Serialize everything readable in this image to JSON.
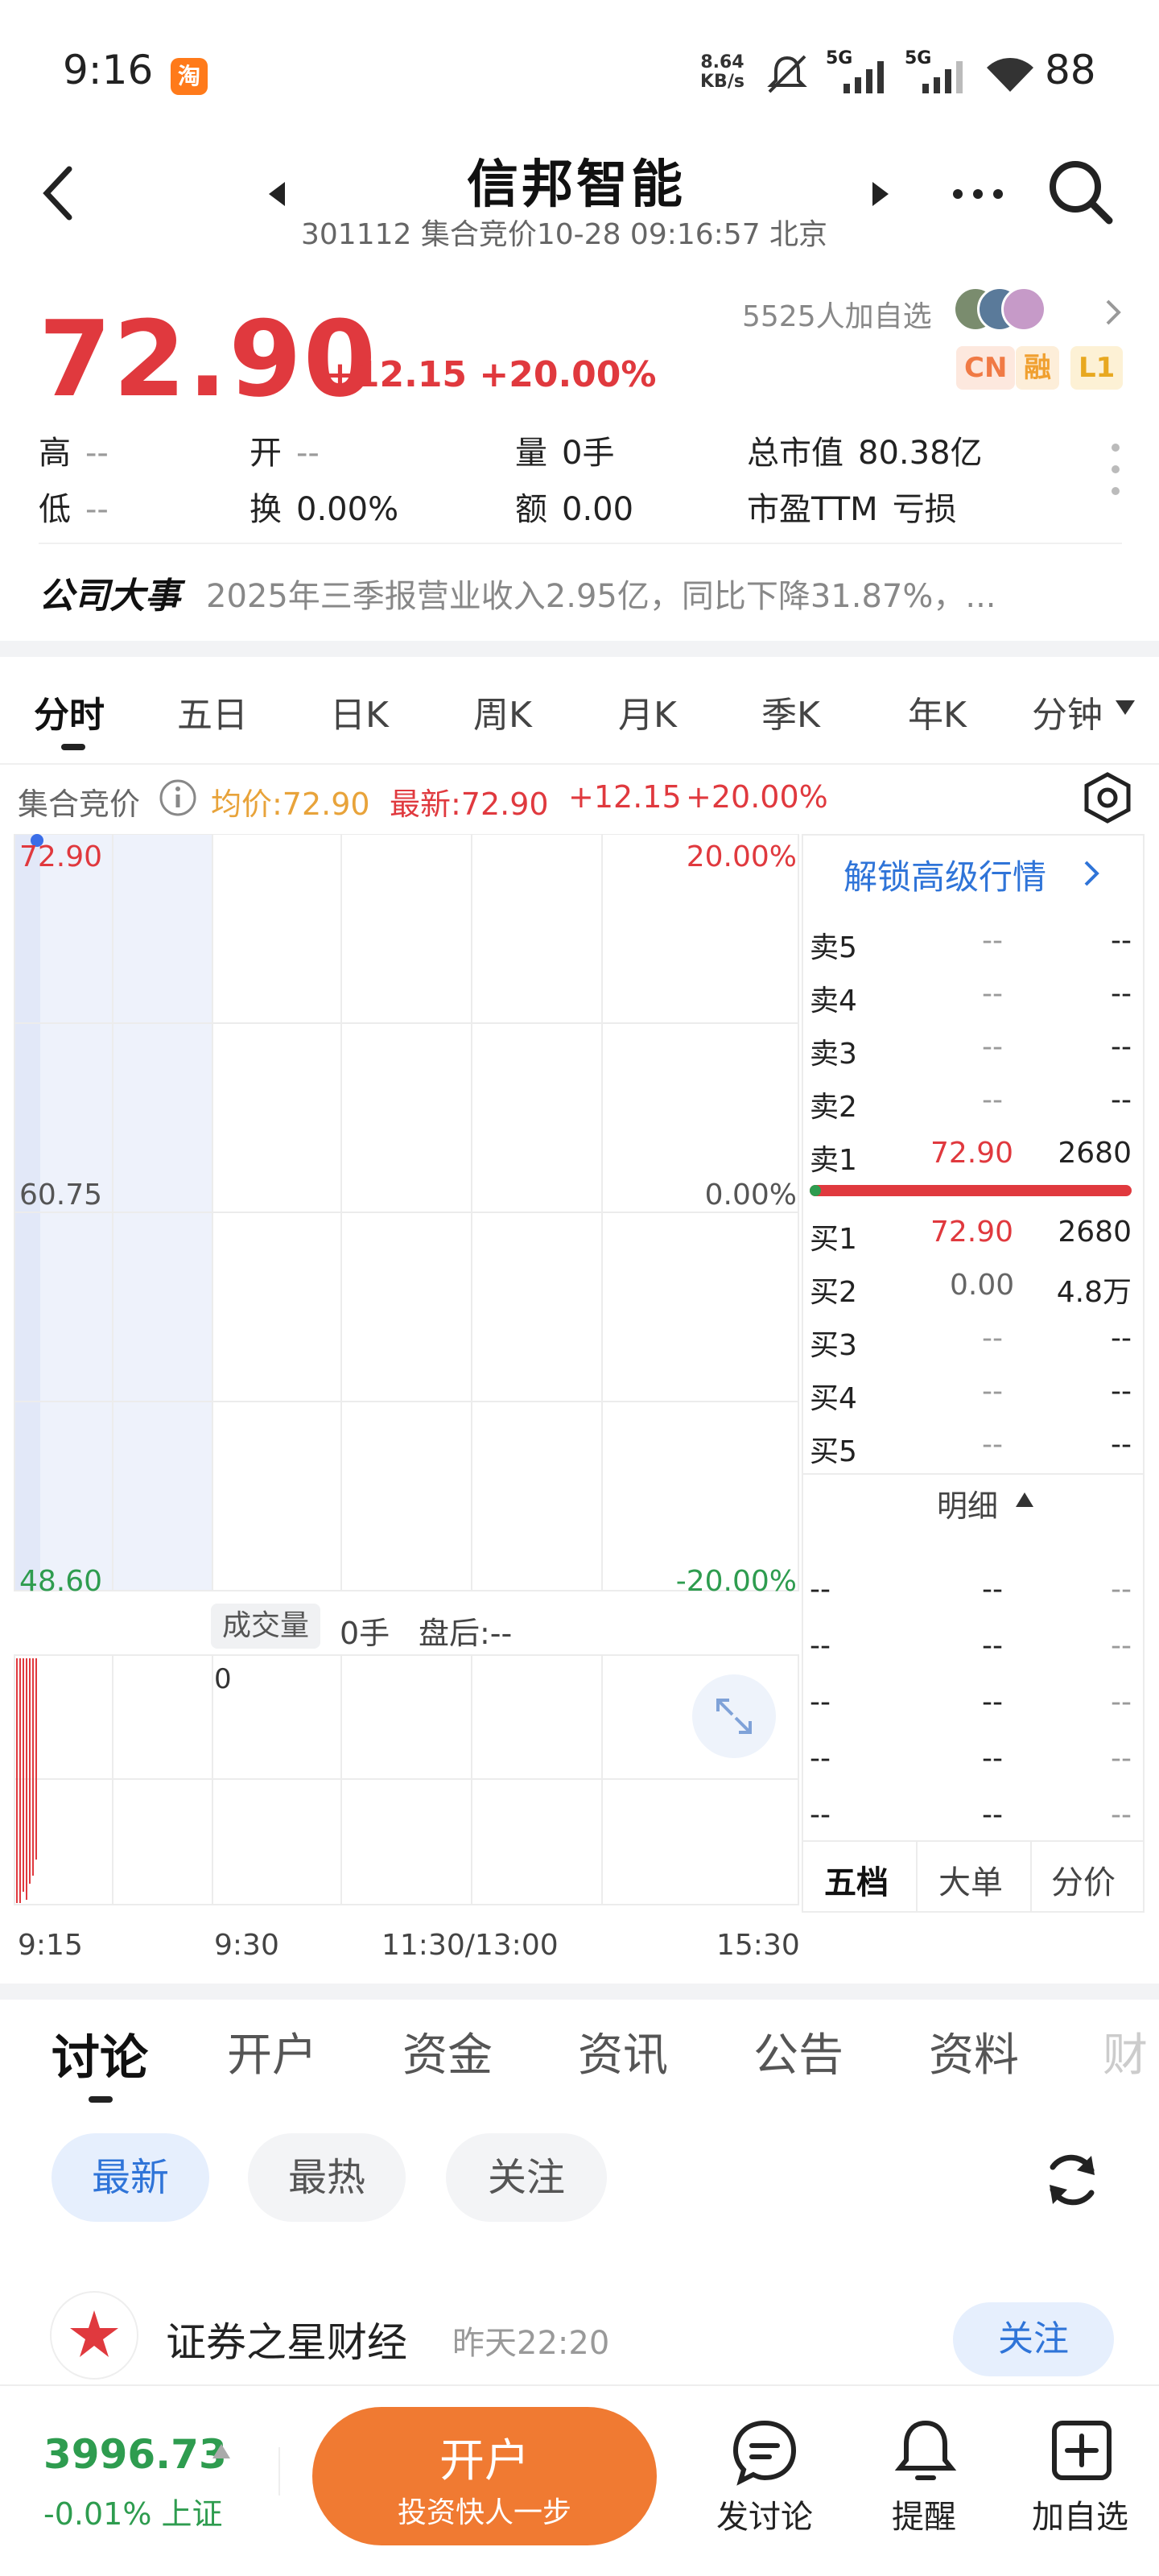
{
  "status_bar": {
    "time": "9:16",
    "app_badge": "淘",
    "net_speed_value": "8.64",
    "net_speed_unit": "KB/s",
    "signal1": "5G",
    "signal2": "5G",
    "battery": "88"
  },
  "header": {
    "title": "信邦智能",
    "subtitle": "301112 集合竞价10-28 09:16:57 北京"
  },
  "quote": {
    "price": "72.90",
    "change": "+12.15 +20.00%",
    "followers": "5525人加自选",
    "badges": [
      "CN",
      "融",
      "L1"
    ],
    "stats": {
      "high_label": "高",
      "high_value": "--",
      "low_label": "低",
      "low_value": "--",
      "open_label": "开",
      "open_value": "--",
      "turnover_label": "换",
      "turnover_value": "0.00%",
      "volume_label": "量",
      "volume_value": "0手",
      "amount_label": "额",
      "amount_value": "0.00",
      "mcap_label": "总市值",
      "mcap_value": "80.38亿",
      "pe_label": "市盈TTM",
      "pe_value": "亏损"
    }
  },
  "events": {
    "label": "公司大事",
    "text": "2025年三季报营业收入2.95亿，同比下降31.87%，..."
  },
  "period_tabs": [
    "分时",
    "五日",
    "日K",
    "周K",
    "月K",
    "季K",
    "年K",
    "分钟"
  ],
  "chart": {
    "header_label": "集合竞价",
    "avg_label": "均价:72.90",
    "latest_label": "最新:72.90",
    "change_value": "+12.15",
    "change_pct": "+20.00%",
    "y_top": "72.90",
    "y_mid": "60.75",
    "y_bot": "48.60",
    "pct_top": "20.00%",
    "pct_mid": "0.00%",
    "pct_bot": "-20.00%",
    "volume_label": "成交量",
    "volume_value": "0手",
    "after_hours": "盘后:--",
    "volume_axis": "0",
    "x_labels": [
      "9:15",
      "9:30",
      "11:30/13:00",
      "15:30"
    ],
    "colors": {
      "up": "#e0393e",
      "down": "#2e9c4f",
      "avg": "#e8a33a"
    }
  },
  "order_book": {
    "unlock": "解锁高级行情",
    "asks": [
      {
        "label": "卖5",
        "price": "--",
        "vol": "--"
      },
      {
        "label": "卖4",
        "price": "--",
        "vol": "--"
      },
      {
        "label": "卖3",
        "price": "--",
        "vol": "--"
      },
      {
        "label": "卖2",
        "price": "--",
        "vol": "--"
      },
      {
        "label": "卖1",
        "price": "72.90",
        "vol": "2680"
      }
    ],
    "bids": [
      {
        "label": "买1",
        "price": "72.90",
        "vol": "2680"
      },
      {
        "label": "买2",
        "price": "0.00",
        "vol": "4.8万"
      },
      {
        "label": "买3",
        "price": "--",
        "vol": "--"
      },
      {
        "label": "买4",
        "price": "--",
        "vol": "--"
      },
      {
        "label": "买5",
        "price": "--",
        "vol": "--"
      }
    ],
    "detail_label": "明细",
    "detail_rows": [
      [
        "--",
        "--",
        "--"
      ],
      [
        "--",
        "--",
        "--"
      ],
      [
        "--",
        "--",
        "--"
      ],
      [
        "--",
        "--",
        "--"
      ],
      [
        "--",
        "--",
        "--"
      ]
    ],
    "tabs": [
      "五档",
      "大单",
      "分价"
    ]
  },
  "content_tabs": [
    "讨论",
    "开户",
    "资金",
    "资讯",
    "公告",
    "资料",
    "财"
  ],
  "filters": [
    "最新",
    "最热",
    "关注"
  ],
  "post": {
    "author": "证券之星财经",
    "time": "昨天22:20",
    "follow": "关注"
  },
  "bottom_bar": {
    "index_value": "3996.73",
    "index_change": "-0.01% 上证",
    "open_account": "开户",
    "open_account_sub": "投资快人一步",
    "discuss": "发讨论",
    "alert": "提醒",
    "add_watch": "加自选"
  }
}
